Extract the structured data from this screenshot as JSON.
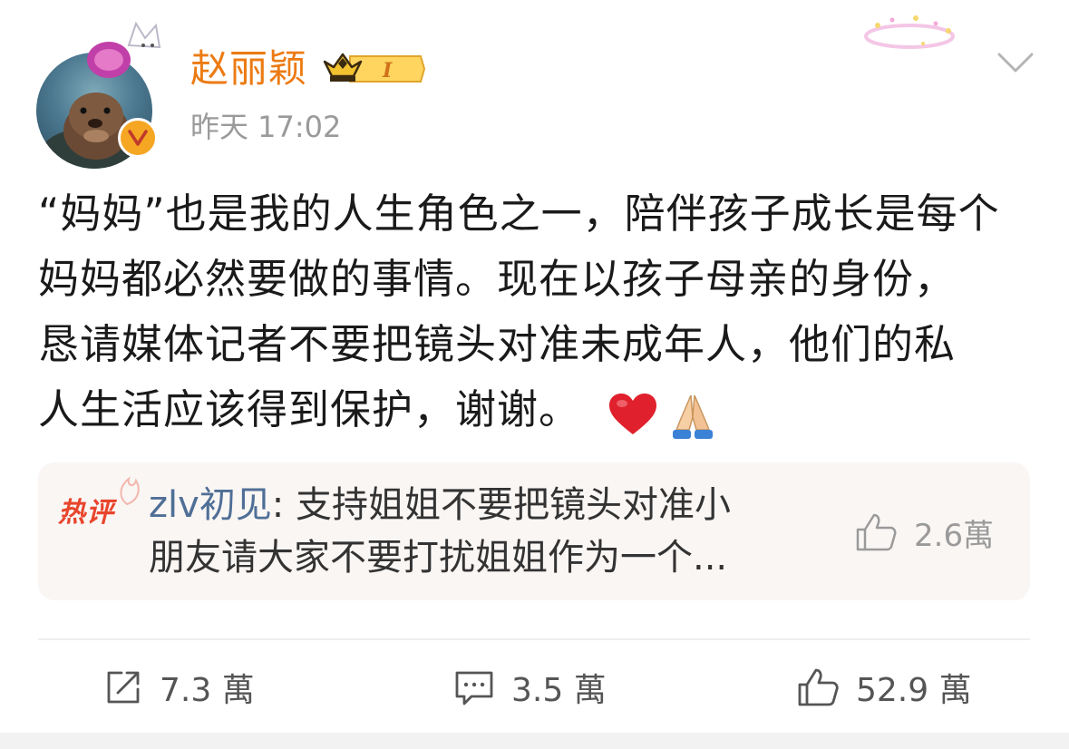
{
  "author": {
    "name": "赵丽颖",
    "timestamp": "昨天 17:02",
    "vip_level": "I"
  },
  "post": {
    "lines": [
      "“妈妈”也是我的人生角色之一，陪伴孩子成长是每个",
      "妈妈都必然要做的事情。现在以孩子母亲的身份，",
      "恳请媒体记者不要把镜头对准未成年人，他们的私",
      "人生活应该得到保护，谢谢。"
    ],
    "emojis": [
      "red-heart-emoji",
      "folded-hands-emoji"
    ]
  },
  "hot_comment": {
    "label": "热评",
    "author": "zlv初见",
    "separator": ": ",
    "text_line1": "支持姐姐不要把镜头对准小",
    "text_line2": "朋友请大家不要打扰姐姐作为一个...",
    "likes": "2.6萬"
  },
  "actions": {
    "repost": {
      "icon": "share-icon",
      "count": "7.3 萬"
    },
    "comment": {
      "icon": "comment-icon",
      "count": "3.5 萬"
    },
    "like": {
      "icon": "thumbs-up-icon",
      "count": "52.9 萬"
    }
  },
  "colors": {
    "username": "#ec7b14",
    "comment_author": "#4f6f96",
    "hot_label": "#e8452c",
    "verified": "#f5a623",
    "muted": "#9a9a9a"
  }
}
